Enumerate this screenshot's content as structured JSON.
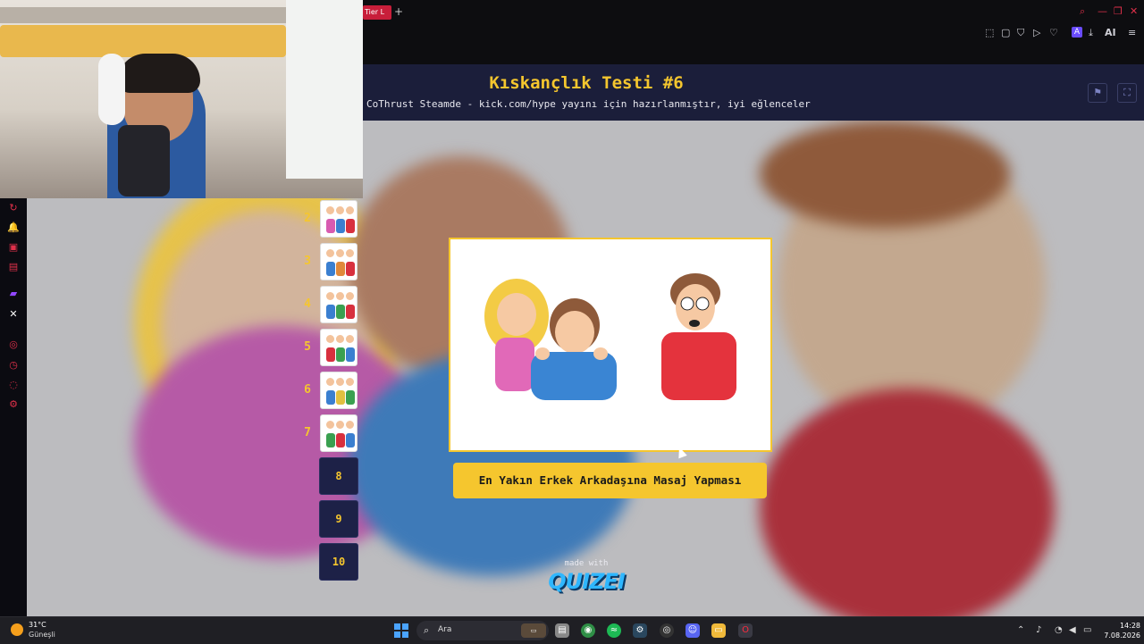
{
  "browser": {
    "tab_label": "Tier L",
    "new_tab_icon": "+",
    "toolbar_icons": [
      "bookmark-icon",
      "tab-icon",
      "shield-icon",
      "play-icon",
      "heart-icon",
      "extension-icon",
      "download-icon",
      "ai-icon",
      "menu-icon"
    ],
    "ai_label": "AI",
    "window_controls": [
      "search-icon",
      "minimize-icon",
      "restore-icon",
      "close-icon"
    ]
  },
  "quiz": {
    "title": "Kıskançlık Testi #6",
    "subtitle": "CoThrust Steamde - kick.com/hype yayını için hazırlanmıştır, iyi eğlenceler",
    "header_buttons": [
      "flag-icon",
      "fullscreen-icon"
    ],
    "items": [
      {
        "number": "2",
        "has_image": true
      },
      {
        "number": "3",
        "has_image": true
      },
      {
        "number": "4",
        "has_image": true
      },
      {
        "number": "5",
        "has_image": true
      },
      {
        "number": "6",
        "has_image": true
      },
      {
        "number": "7",
        "has_image": true
      },
      {
        "number": "8",
        "has_image": false
      },
      {
        "number": "9",
        "has_image": false
      },
      {
        "number": "10",
        "has_image": false
      }
    ],
    "caption": "En Yakın Erkek Arkadaşına Masaj Yapması",
    "made_with": "made with",
    "brand": "QUIZEI",
    "accent_color": "#f5c62e",
    "brand_color": "#2fb7ff"
  },
  "taskbar": {
    "temperature": "31°C",
    "condition": "Güneşli",
    "search_placeholder": "Ara",
    "apps": [
      "windows-start-icon",
      "search-icon",
      "file-icon",
      "chrome-icon",
      "spotify-icon",
      "steam-icon",
      "obs-icon",
      "discord-icon",
      "explorer-icon",
      "opera-icon"
    ],
    "time": "14:28",
    "date": "7.08.2026"
  },
  "stream_sidebar": {
    "icons": [
      "refresh-icon",
      "alert-icon",
      "chat-icon",
      "mail-icon",
      "twitch-icon",
      "x-icon",
      "settings-icon",
      "history-icon",
      "gift-icon",
      "gear-icon"
    ]
  }
}
